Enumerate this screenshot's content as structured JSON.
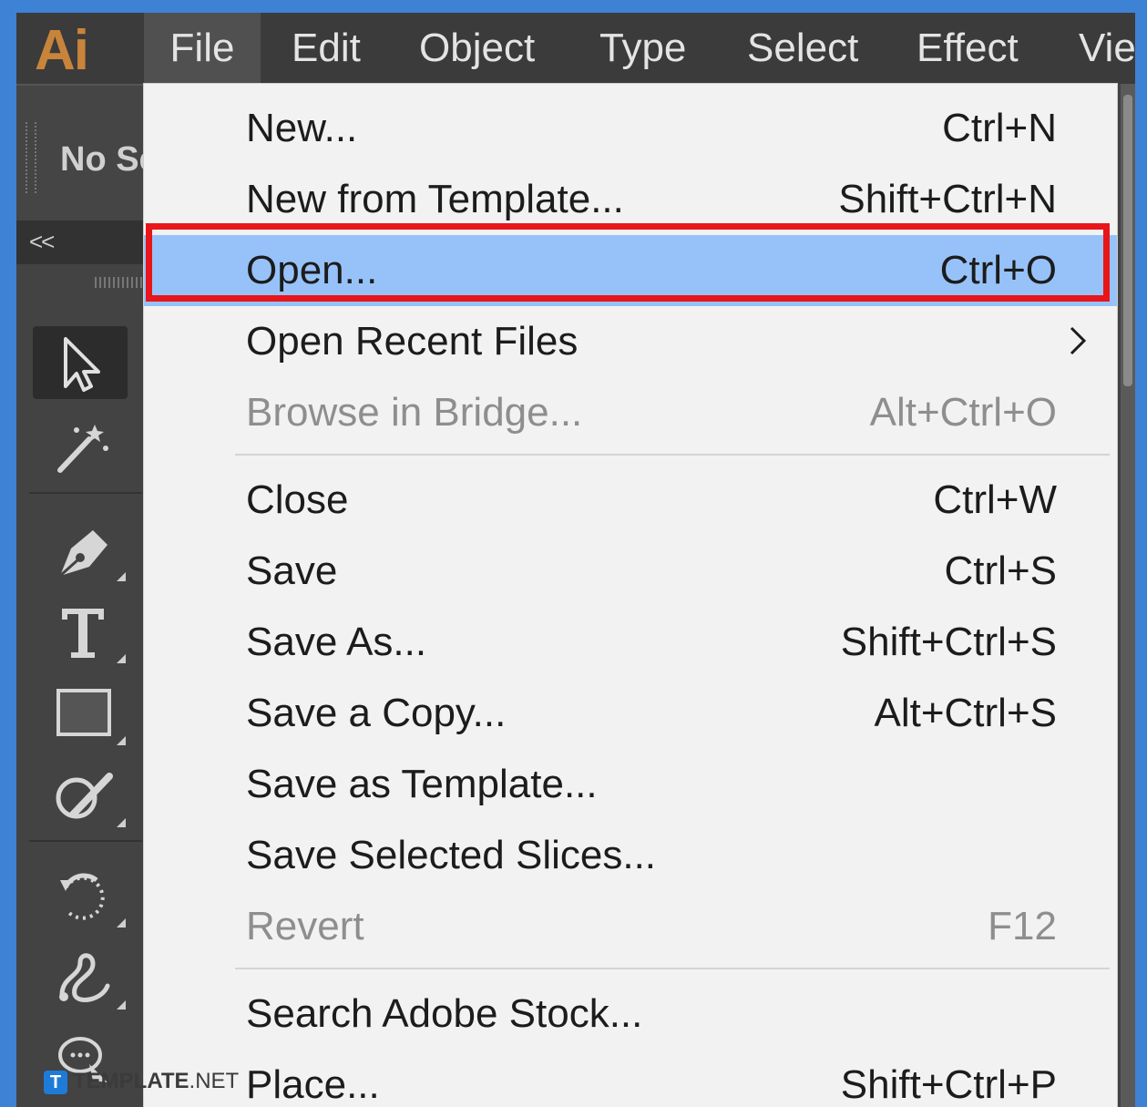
{
  "app": {
    "logo": "Ai",
    "menus": [
      "File",
      "Edit",
      "Object",
      "Type",
      "Select",
      "Effect",
      "Vie"
    ],
    "active_menu": "File",
    "control_bar_text": "No Se",
    "collapse_label": "<<"
  },
  "toolbar": {
    "tools": [
      "selection-tool-icon",
      "magic-wand-tool-icon",
      "pen-tool-icon",
      "type-tool-icon",
      "rectangle-tool-icon",
      "shaper-tool-icon",
      "rotate-tool-icon",
      "warp-tool-icon",
      "comment-tool-icon"
    ]
  },
  "file_menu": {
    "items": [
      {
        "label": "New...",
        "shortcut": "Ctrl+N",
        "enabled": true
      },
      {
        "label": "New from Template...",
        "shortcut": "Shift+Ctrl+N",
        "enabled": true
      },
      {
        "label": "Open...",
        "shortcut": "Ctrl+O",
        "enabled": true,
        "highlighted": true
      },
      {
        "label": "Open Recent Files",
        "shortcut": "",
        "enabled": true,
        "submenu": true
      },
      {
        "label": "Browse in Bridge...",
        "shortcut": "Alt+Ctrl+O",
        "enabled": false
      },
      {
        "label": "Close",
        "shortcut": "Ctrl+W",
        "enabled": true
      },
      {
        "label": "Save",
        "shortcut": "Ctrl+S",
        "enabled": true
      },
      {
        "label": "Save As...",
        "shortcut": "Shift+Ctrl+S",
        "enabled": true
      },
      {
        "label": "Save a Copy...",
        "shortcut": "Alt+Ctrl+S",
        "enabled": true
      },
      {
        "label": "Save as Template...",
        "shortcut": "",
        "enabled": true
      },
      {
        "label": "Save Selected Slices...",
        "shortcut": "",
        "enabled": true
      },
      {
        "label": "Revert",
        "shortcut": "F12",
        "enabled": false
      },
      {
        "label": "Search Adobe Stock...",
        "shortcut": "",
        "enabled": true
      },
      {
        "label": "Place...",
        "shortcut": "Shift+Ctrl+P",
        "enabled": true
      }
    ]
  },
  "watermark": {
    "badge": "T",
    "brand": "TEMPLATE",
    "suffix": ".NET"
  },
  "colors": {
    "highlight": "#97c2f9",
    "annotation_border": "#e8151b",
    "frame": "#3e82d6",
    "ui_dark": "#434343",
    "menu_bg": "#f2f2f2"
  }
}
